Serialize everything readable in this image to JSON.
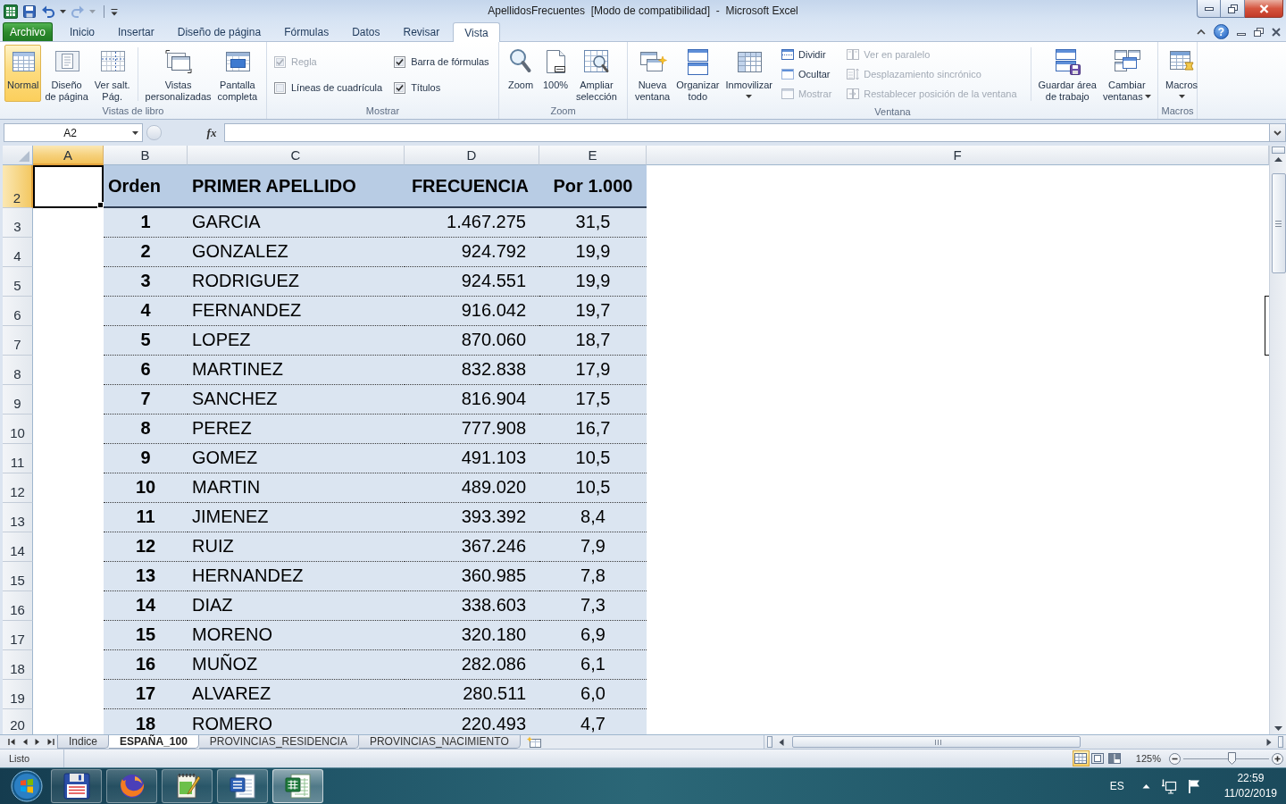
{
  "window": {
    "title": "ApellidosFrecuentes  [Modo de compatibilidad]  -  Microsoft Excel"
  },
  "quick_access": [
    {
      "kind": "save",
      "disabled": false
    },
    {
      "kind": "undo",
      "disabled": false
    },
    {
      "kind": "redo",
      "disabled": true
    },
    {
      "kind": "customize",
      "disabled": false
    }
  ],
  "ribbon": {
    "tabs": [
      {
        "label": "Archivo",
        "kind": "file",
        "selected": false
      },
      {
        "label": "Inicio",
        "kind": "tab",
        "selected": false
      },
      {
        "label": "Insertar",
        "kind": "tab",
        "selected": false
      },
      {
        "label": "Diseño de página",
        "kind": "tab",
        "selected": false
      },
      {
        "label": "Fórmulas",
        "kind": "tab",
        "selected": false
      },
      {
        "label": "Datos",
        "kind": "tab",
        "selected": false
      },
      {
        "label": "Revisar",
        "kind": "tab",
        "selected": false
      },
      {
        "label": "Vista",
        "kind": "tab",
        "selected": true
      }
    ],
    "help": "?",
    "groups": [
      {
        "label": "Vistas de libro",
        "items": [
          {
            "kind": "large",
            "label": "Normal",
            "selected": true
          },
          {
            "kind": "large",
            "label": "Diseño\nde página",
            "selected": false
          },
          {
            "kind": "large",
            "label": "Ver salt.\nPág.",
            "selected": false
          },
          {
            "kind": "separator"
          },
          {
            "kind": "large",
            "label": "Vistas\npersonalizadas",
            "selected": false
          },
          {
            "kind": "large",
            "label": "Pantalla\ncompleta",
            "selected": false
          }
        ]
      },
      {
        "label": "Mostrar",
        "items": [
          {
            "kind": "stack",
            "items": [
              {
                "kind": "checkbox",
                "label": "Regla",
                "checked": true,
                "disabled": true
              },
              {
                "kind": "checkbox",
                "label": "Líneas de cuadrícula",
                "checked": false,
                "disabled": false
              }
            ]
          },
          {
            "kind": "stack",
            "items": [
              {
                "kind": "checkbox",
                "label": "Barra de fórmulas",
                "checked": true,
                "disabled": false
              },
              {
                "kind": "checkbox",
                "label": "Títulos",
                "checked": true,
                "disabled": false
              }
            ]
          }
        ]
      },
      {
        "label": "Zoom",
        "items": [
          {
            "kind": "large",
            "label": "Zoom"
          },
          {
            "kind": "large",
            "label": "100%"
          },
          {
            "kind": "large",
            "label": "Ampliar\nselección"
          }
        ]
      },
      {
        "label": "Ventana",
        "items": [
          {
            "kind": "large",
            "label": "Nueva\nventana",
            "menu": false
          },
          {
            "kind": "large",
            "label": "Organizar\ntodo",
            "menu": false
          },
          {
            "kind": "large",
            "label": "Inmovilizar",
            "menu": true
          },
          {
            "kind": "stack",
            "items": [
              {
                "kind": "button",
                "label": "Dividir",
                "disabled": false
              },
              {
                "kind": "button",
                "label": "Ocultar",
                "disabled": false
              },
              {
                "kind": "button",
                "label": "Mostrar",
                "disabled": true
              }
            ]
          },
          {
            "kind": "stack",
            "items": [
              {
                "kind": "button",
                "label": "Ver en paralelo",
                "disabled": true
              },
              {
                "kind": "button",
                "label": "Desplazamiento sincrónico",
                "disabled": true
              },
              {
                "kind": "button",
                "label": "Restablecer posición de la ventana",
                "disabled": true
              }
            ]
          },
          {
            "kind": "separator"
          },
          {
            "kind": "large",
            "label": "Guardar área\nde trabajo",
            "menu": false
          },
          {
            "kind": "large",
            "label": "Cambiar\nventanas",
            "menu": true
          }
        ]
      },
      {
        "label": "Macros",
        "items": [
          {
            "kind": "large",
            "label": "Macros",
            "menu": true
          }
        ]
      }
    ]
  },
  "formula_bar": {
    "name_box": "A2",
    "function_button": "fx"
  },
  "sheet": {
    "columns": [
      {
        "label": "A",
        "selected": true
      },
      {
        "label": "B",
        "selected": false
      },
      {
        "label": "C",
        "selected": false
      },
      {
        "label": "D",
        "selected": false
      },
      {
        "label": "E",
        "selected": false
      },
      {
        "label": "F",
        "selected": false
      }
    ],
    "rows": [
      {
        "number": "2",
        "kind": "header",
        "selected": true,
        "cells": [
          "",
          "Orden",
          "PRIMER APELLIDO",
          "FRECUENCIA",
          "Por 1.000"
        ]
      },
      {
        "number": "3",
        "kind": "data",
        "selected": false,
        "cells": [
          "",
          "1",
          "GARCIA",
          "1.467.275",
          "31,5"
        ]
      },
      {
        "number": "4",
        "kind": "data",
        "selected": false,
        "cells": [
          "",
          "2",
          "GONZALEZ",
          "924.792",
          "19,9"
        ]
      },
      {
        "number": "5",
        "kind": "data",
        "selected": false,
        "cells": [
          "",
          "3",
          "RODRIGUEZ",
          "924.551",
          "19,9"
        ]
      },
      {
        "number": "6",
        "kind": "data",
        "selected": false,
        "cells": [
          "",
          "4",
          "FERNANDEZ",
          "916.042",
          "19,7"
        ]
      },
      {
        "number": "7",
        "kind": "data",
        "selected": false,
        "cells": [
          "",
          "5",
          "LOPEZ",
          "870.060",
          "18,7"
        ]
      },
      {
        "number": "8",
        "kind": "data",
        "selected": false,
        "cells": [
          "",
          "6",
          "MARTINEZ",
          "832.838",
          "17,9"
        ]
      },
      {
        "number": "9",
        "kind": "data",
        "selected": false,
        "cells": [
          "",
          "7",
          "SANCHEZ",
          "816.904",
          "17,5"
        ]
      },
      {
        "number": "10",
        "kind": "data",
        "selected": false,
        "cells": [
          "",
          "8",
          "PEREZ",
          "777.908",
          "16,7"
        ]
      },
      {
        "number": "11",
        "kind": "data",
        "selected": false,
        "cells": [
          "",
          "9",
          "GOMEZ",
          "491.103",
          "10,5"
        ]
      },
      {
        "number": "12",
        "kind": "data",
        "selected": false,
        "cells": [
          "",
          "10",
          "MARTIN",
          "489.020",
          "10,5"
        ]
      },
      {
        "number": "13",
        "kind": "data",
        "selected": false,
        "cells": [
          "",
          "11",
          "JIMENEZ",
          "393.392",
          "8,4"
        ]
      },
      {
        "number": "14",
        "kind": "data",
        "selected": false,
        "cells": [
          "",
          "12",
          "RUIZ",
          "367.246",
          "7,9"
        ]
      },
      {
        "number": "15",
        "kind": "data",
        "selected": false,
        "cells": [
          "",
          "13",
          "HERNANDEZ",
          "360.985",
          "7,8"
        ]
      },
      {
        "number": "16",
        "kind": "data",
        "selected": false,
        "cells": [
          "",
          "14",
          "DIAZ",
          "338.603",
          "7,3"
        ]
      },
      {
        "number": "17",
        "kind": "data",
        "selected": false,
        "cells": [
          "",
          "15",
          "MORENO",
          "320.180",
          "6,9"
        ]
      },
      {
        "number": "18",
        "kind": "data",
        "selected": false,
        "cells": [
          "",
          "16",
          "MUÑOZ",
          "282.086",
          "6,1"
        ]
      },
      {
        "number": "19",
        "kind": "data",
        "selected": false,
        "cells": [
          "",
          "17",
          "ALVAREZ",
          "280.511",
          "6,0"
        ]
      },
      {
        "number": "20",
        "kind": "data",
        "selected": false,
        "cells": [
          "",
          "18",
          "ROMERO",
          "220.493",
          "4,7"
        ]
      }
    ]
  },
  "sheet_tabs": [
    {
      "label": "Indice",
      "selected": false
    },
    {
      "label": "ESPAÑA_100",
      "selected": true
    },
    {
      "label": "PROVINCIAS_RESIDENCIA",
      "selected": false
    },
    {
      "label": "PROVINCIAS_NACIMIENTO",
      "selected": false
    }
  ],
  "status_bar": {
    "status": "Listo",
    "views": [
      {
        "kind": "normal",
        "selected": true
      },
      {
        "kind": "page-layout",
        "selected": false
      },
      {
        "kind": "page-break",
        "selected": false
      }
    ],
    "zoom": {
      "label": "125%",
      "level": 0.56
    }
  },
  "taskbar": {
    "apps": [
      {
        "kind": "floppy",
        "selected": false
      },
      {
        "kind": "globe",
        "selected": false
      },
      {
        "kind": "notepad",
        "selected": false
      },
      {
        "kind": "document",
        "selected": false
      },
      {
        "kind": "spreadsheet",
        "selected": true
      }
    ],
    "language": "ES",
    "time": "22:59",
    "date": "11/02/2019"
  }
}
